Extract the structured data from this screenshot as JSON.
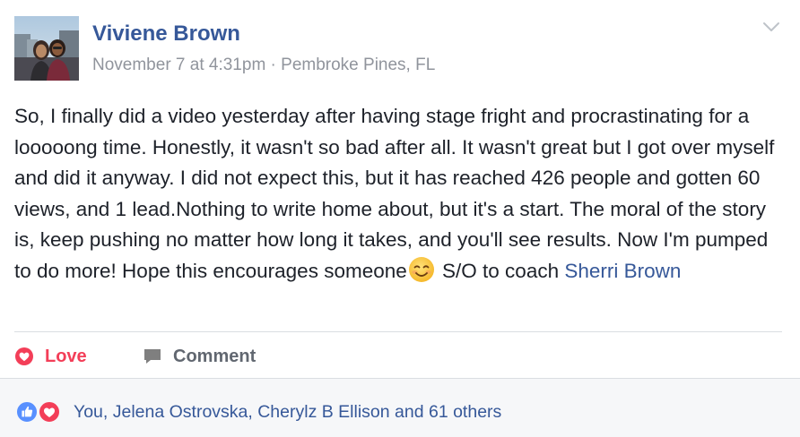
{
  "post": {
    "author": "Viviene Brown",
    "date": "November 7 at 4:31pm",
    "separator": "·",
    "location": "Pembroke Pines, FL",
    "text_main": "So, I finally did a video yesterday after having stage fright and procrastinating for a looooong time. Honestly, it wasn't so bad after all. It wasn't great but I got over myself and did it anyway. I did not expect this, but it has reached 426 people and gotten 60 views, and 1 lead.Nothing to write home about, but it's a start. The moral of the story is, keep pushing no matter how long it takes, and you'll see results. Now I'm pumped to do more! Hope this encourages someone",
    "text_after_emoji": "S/O to coach ",
    "mention": "Sherri Brown"
  },
  "actions": {
    "love_label": "Love",
    "comment_label": "Comment"
  },
  "reactions": {
    "summary": "You, Jelena Ostrovska, Cherylz B Ellison and 61 others"
  },
  "icons": {
    "options": "chevron-down-icon",
    "love": "heart-icon",
    "comment": "speech-bubble-icon",
    "emoji": "smiling-face-icon",
    "like_reaction": "thumbs-up-icon",
    "love_reaction": "heart-icon"
  },
  "colors": {
    "link": "#365899",
    "love": "#f33e58",
    "like": "#5890ff",
    "text": "#1d2129",
    "muted": "#90949c"
  }
}
